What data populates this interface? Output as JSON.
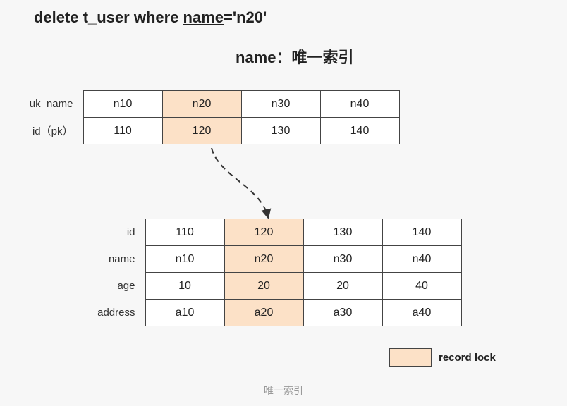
{
  "sql_prefix": "delete t_user where ",
  "sql_field": "name",
  "sql_suffix": "='n20'",
  "subtitle": "name：唯一索引",
  "index_table": {
    "rows": [
      {
        "label": "uk_name",
        "cells": [
          "n10",
          "n20",
          "n30",
          "n40"
        ]
      },
      {
        "label": "id（pk）",
        "cells": [
          "110",
          "120",
          "130",
          "140"
        ]
      }
    ],
    "highlight_col": 1
  },
  "main_table": {
    "rows": [
      {
        "label": "id",
        "cells": [
          "110",
          "120",
          "130",
          "140"
        ]
      },
      {
        "label": "name",
        "cells": [
          "n10",
          "n20",
          "n30",
          "n40"
        ]
      },
      {
        "label": "age",
        "cells": [
          "10",
          "20",
          "20",
          "40"
        ]
      },
      {
        "label": "address",
        "cells": [
          "a10",
          "a20",
          "a30",
          "a40"
        ]
      }
    ],
    "highlight_col": 1
  },
  "legend_label": "record lock",
  "caption": "唯一索引"
}
